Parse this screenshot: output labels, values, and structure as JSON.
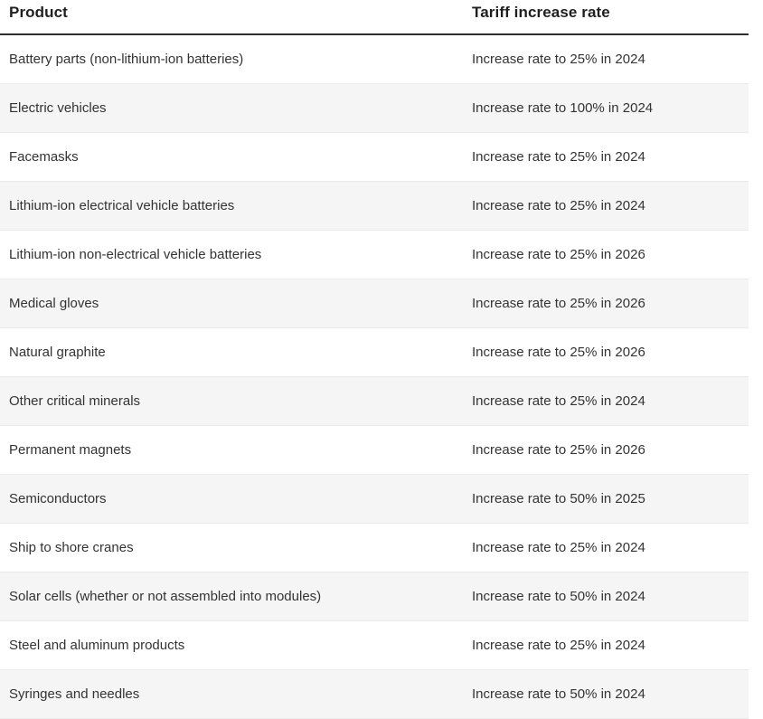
{
  "table": {
    "columns": [
      {
        "key": "product",
        "label": "Product"
      },
      {
        "key": "rate",
        "label": "Tariff increase rate"
      }
    ],
    "rows": [
      {
        "product": "Battery parts (non-lithium-ion batteries)",
        "rate": "Increase rate to 25% in 2024"
      },
      {
        "product": "Electric vehicles",
        "rate": "Increase rate to 100% in 2024"
      },
      {
        "product": "Facemasks",
        "rate": "Increase rate to 25% in 2024"
      },
      {
        "product": "Lithium-ion electrical vehicle batteries",
        "rate": "Increase rate to 25% in 2024"
      },
      {
        "product": "Lithium-ion non-electrical vehicle batteries",
        "rate": "Increase rate to 25% in 2026"
      },
      {
        "product": "Medical gloves",
        "rate": "Increase rate to 25% in 2026"
      },
      {
        "product": "Natural graphite",
        "rate": "Increase rate to 25% in 2026"
      },
      {
        "product": "Other critical minerals",
        "rate": "Increase rate to 25% in 2024"
      },
      {
        "product": "Permanent magnets",
        "rate": "Increase rate to 25% in 2026"
      },
      {
        "product": "Semiconductors",
        "rate": "Increase rate to 50% in 2025"
      },
      {
        "product": "Ship to shore cranes",
        "rate": "Increase rate to 25% in 2024"
      },
      {
        "product": "Solar cells (whether or not assembled into modules)",
        "rate": "Increase rate to 50% in 2024"
      },
      {
        "product": "Steel and aluminum products",
        "rate": "Increase rate to 25% in 2024"
      },
      {
        "product": "Syringes and needles",
        "rate": "Increase rate to 50% in 2024"
      }
    ]
  },
  "colors": {
    "header_rule": "#2e2e2e",
    "header_text": "#1f1f1f",
    "body_text": "#333333",
    "row_even_bg": "#f5f5f5",
    "row_odd_bg": "#ffffff",
    "row_divider": "#eaeaea"
  }
}
